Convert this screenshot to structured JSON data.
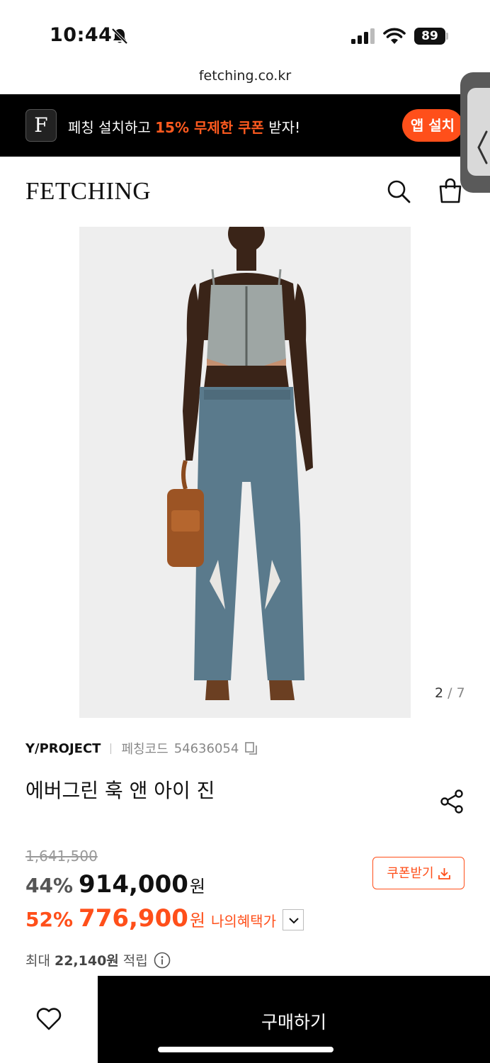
{
  "status_bar": {
    "time": "10:44",
    "battery": "89"
  },
  "browser": {
    "url": "fetching.co.kr"
  },
  "promo_banner": {
    "app_icon_letter": "F",
    "text_before": "페칭 설치하고 ",
    "text_highlight": "15% 무제한 쿠폰",
    "text_after": " 받자!",
    "install_label": "앱 설치"
  },
  "header": {
    "logo": "FETCHING"
  },
  "gallery": {
    "current": "2",
    "separator": " / ",
    "total": "7"
  },
  "product": {
    "brand": "Y/PROJECT",
    "code_label": "페칭코드",
    "code": "54636054",
    "title": "에버그린 훅 앤 아이 진"
  },
  "pricing": {
    "original_price": "1,641,500",
    "coupon_label": "쿠폰받기",
    "discount_1": "44%",
    "price_1": "914,000",
    "currency": "원",
    "discount_2": "52%",
    "price_2": "776,900",
    "benefit_label": "나의혜택가"
  },
  "points": {
    "prefix": "최대",
    "value": "22,140원",
    "suffix": "적립"
  },
  "bottom_bar": {
    "buy_label": "구매하기"
  },
  "colors": {
    "accent": "#ff4f1a",
    "dark": "#000000"
  },
  "icons": [
    "bell-slash-icon",
    "signal-icon",
    "wifi-icon",
    "chevron-left-icon",
    "search-icon",
    "bag-icon",
    "copy-icon",
    "share-icon",
    "download-icon",
    "chevron-down-icon",
    "info-icon",
    "heart-icon"
  ]
}
